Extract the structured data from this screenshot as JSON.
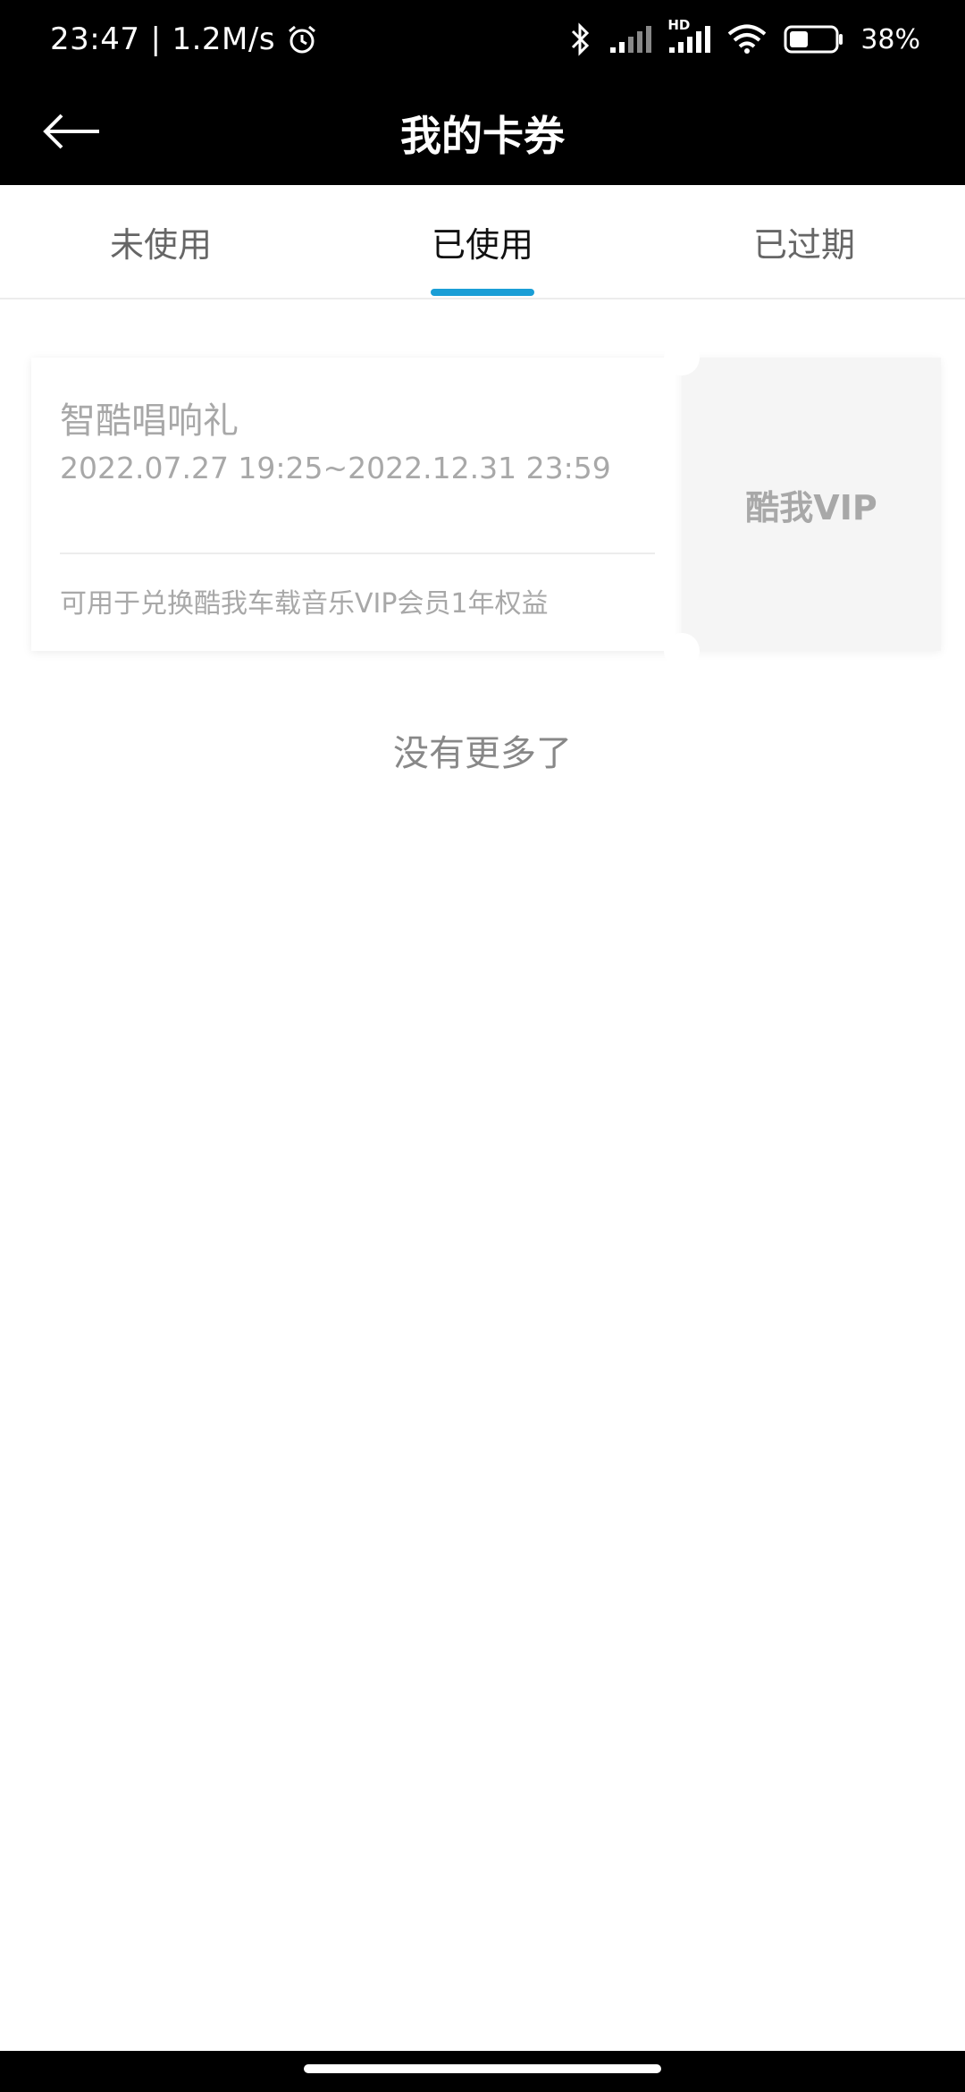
{
  "status_bar": {
    "time": "23:47",
    "separator": "|",
    "net_speed": "1.2M/s",
    "hd_label": "HD",
    "battery": "38%"
  },
  "header": {
    "title": "我的卡券"
  },
  "tabs": [
    {
      "label": "未使用",
      "active": false
    },
    {
      "label": "已使用",
      "active": true
    },
    {
      "label": "已过期",
      "active": false
    }
  ],
  "colors": {
    "accent": "#1a9ed6",
    "header_bg": "#000000"
  },
  "coupons": [
    {
      "name": "智酷唱响礼",
      "validity": "2022.07.27 19:25~2022.12.31 23:59",
      "description": "可用于兑换酷我车载音乐VIP会员1年权益",
      "tag": "酷我VIP"
    }
  ],
  "footer": {
    "no_more": "没有更多了"
  },
  "icons": {
    "back": "arrow-left-icon",
    "alarm": "alarm-clock-icon",
    "bluetooth": "bluetooth-icon",
    "signal": "signal-icon",
    "wifi": "wifi-icon",
    "battery": "battery-icon"
  }
}
